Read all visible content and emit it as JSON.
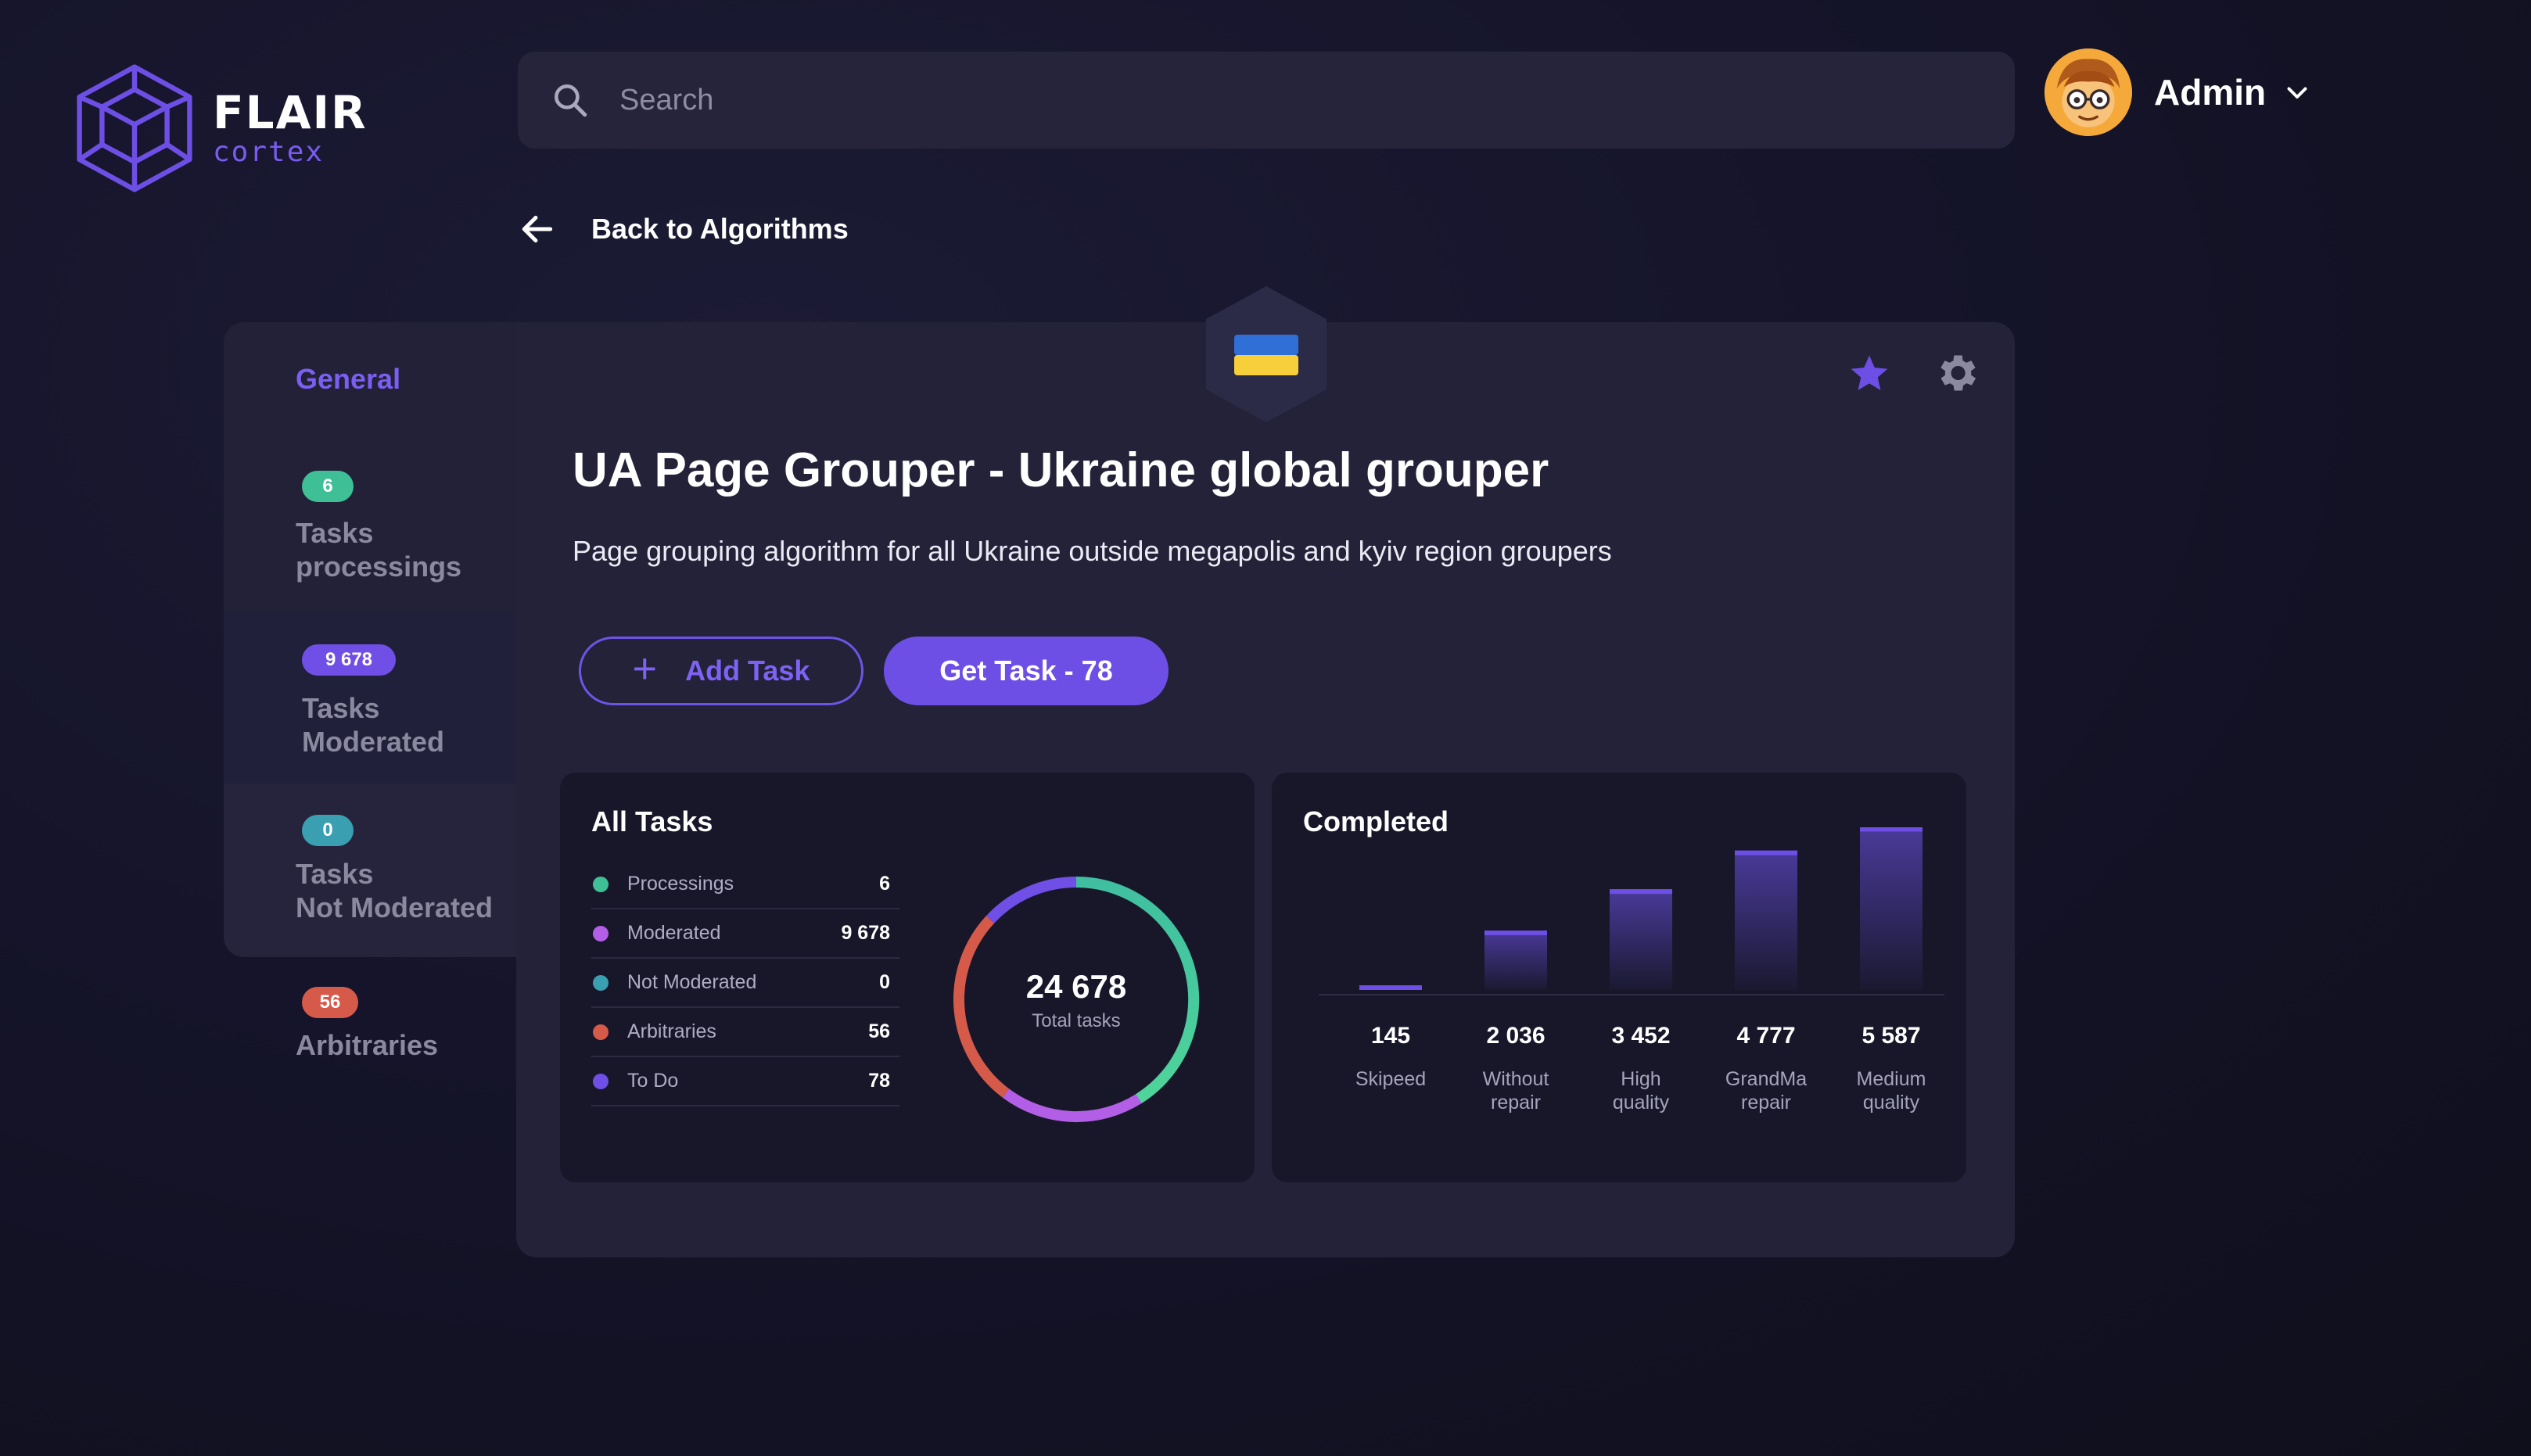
{
  "brand": {
    "name": "FLAIR",
    "sub": "cortex"
  },
  "search": {
    "placeholder": "Search"
  },
  "user": {
    "name": "Admin"
  },
  "back": {
    "label": "Back to Algorithms"
  },
  "sidebar": {
    "general": "General",
    "items": [
      {
        "badge": "6",
        "label_line1": "Tasks",
        "label_line2": "processings",
        "badge_color": "#3fbf95"
      },
      {
        "badge": "9 678",
        "label_line1": "Tasks",
        "label_line2": "Moderated",
        "badge_color": "#6f4fe6"
      },
      {
        "badge": "0",
        "label_line1": "Tasks",
        "label_line2": "Not Moderated",
        "badge_color": "#3a9fb0"
      },
      {
        "badge": "56",
        "label_line1": "Arbitraries",
        "label_line2": "",
        "badge_color": "#d65a4a"
      }
    ]
  },
  "card": {
    "title": "UA Page Grouper - Ukraine global grouper",
    "description": "Page grouping algorithm for all Ukraine outside megapolis and kyiv region groupers",
    "add_task": "Add Task",
    "get_task": "Get Task - 78",
    "flag_colors": [
      "#2f6fd6",
      "#f7cf3a"
    ]
  },
  "icons": {
    "logo": "cube-logo-icon",
    "search": "search-icon",
    "chevron": "chevron-down-icon",
    "back": "arrow-left-icon",
    "star": "star-icon",
    "gear": "gear-icon",
    "plus": "plus-icon",
    "flag": "ukraine-flag-icon"
  },
  "colors": {
    "accent": "#6d4fe6",
    "processings": "#3fbf95",
    "moderated": "#b25ee6",
    "not_moderated": "#3a9fb0",
    "arbitraries": "#d65a4a",
    "todo": "#6f4fe6"
  },
  "all_tasks": {
    "title": "All Tasks",
    "total": "24 678",
    "total_label": "Total tasks",
    "rows": [
      {
        "label": "Processings",
        "value": "6",
        "color": "#3fbf95"
      },
      {
        "label": "Moderated",
        "value": "9 678",
        "color": "#b25ee6"
      },
      {
        "label": "Not Moderated",
        "value": "0",
        "color": "#3a9fb0"
      },
      {
        "label": "Arbitraries",
        "value": "56",
        "color": "#d65a4a"
      },
      {
        "label": "To Do",
        "value": "78",
        "color": "#6f4fe6"
      }
    ]
  },
  "chart_data": {
    "type": "bar",
    "title": "Completed",
    "categories": [
      "Skipeed",
      "Without repair",
      "High quality",
      "GrandMa repair",
      "Medium quality"
    ],
    "values": [
      145,
      2036,
      3452,
      4777,
      5587
    ],
    "value_labels": [
      "145",
      "2 036",
      "3 452",
      "4 777",
      "5 587"
    ],
    "ylim": [
      0,
      6000
    ],
    "grid": false
  }
}
